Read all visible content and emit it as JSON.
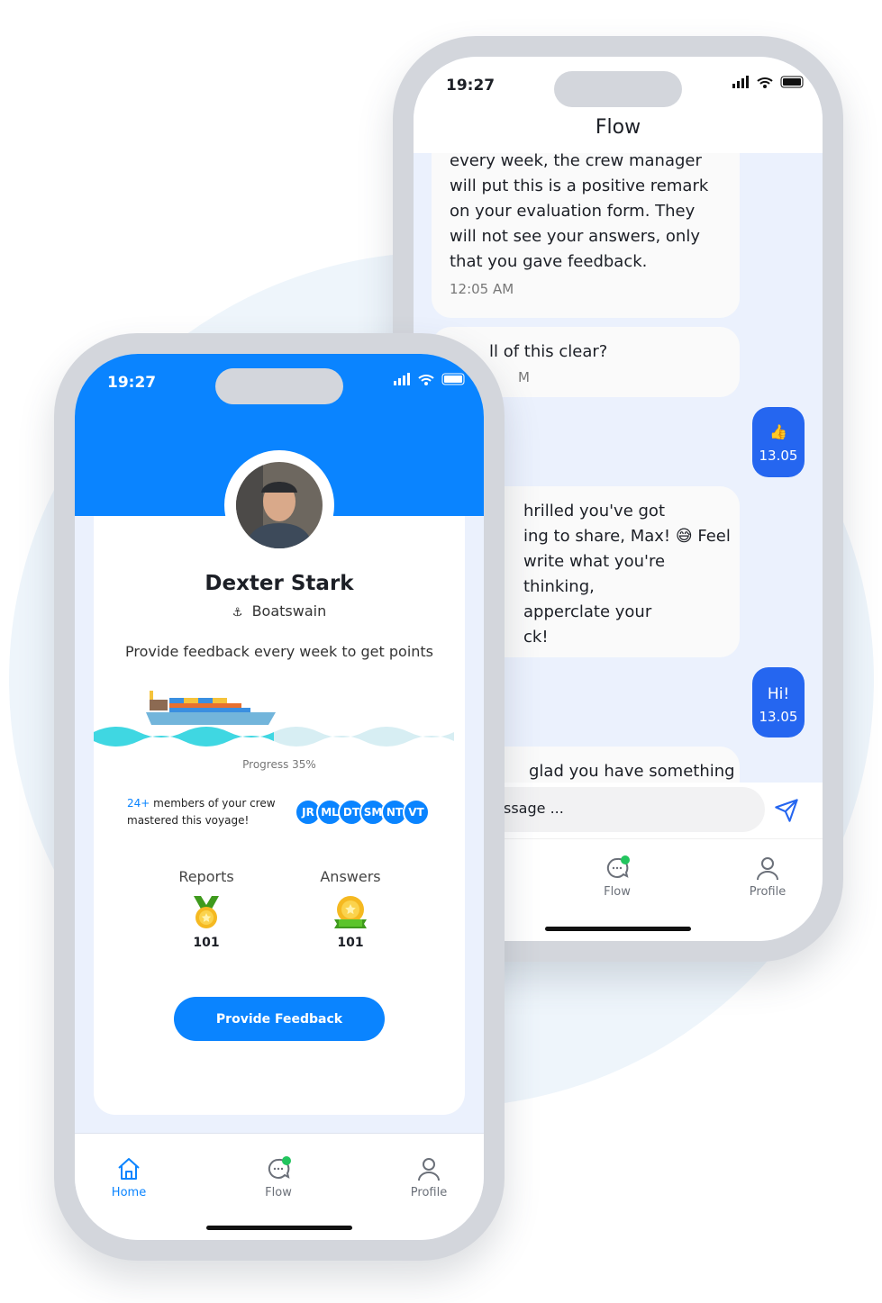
{
  "colors": {
    "accent": "#0a84ff",
    "send": "#2566f0",
    "online": "#22c55e"
  },
  "back_phone": {
    "status_time": "19:27",
    "title": "Flow",
    "messages": [
      {
        "text": "every week, the crew manager will put this is a positive remark on your evaluation form. They will not see your answers, only that you gave feedback.",
        "time": "12:05 AM"
      },
      {
        "text": "ll of this clear?",
        "time": "M"
      },
      {
        "mine": true,
        "emoji": "👍",
        "time": "13.05"
      },
      {
        "lines": [
          "hrilled you've got",
          "ing to share, Max! 😅 Feel",
          "write what you're thinking,",
          "apperclate your",
          "ck!"
        ]
      },
      {
        "mine": true,
        "text": "Hi!",
        "time": "13.05"
      },
      {
        "text": "glad you have something"
      }
    ],
    "input_placeholder": "ssage ...",
    "nav": [
      {
        "label": "Flow",
        "icon": "chat-icon"
      },
      {
        "label": "Profile",
        "icon": "user-icon"
      }
    ]
  },
  "front_phone": {
    "status_time": "19:27",
    "name": "Dexter Stark",
    "role": "Boatswain",
    "prompt": "Provide feedback every week to get points",
    "progress_label": "Progress 35%",
    "progress": 35,
    "crew_count": "24+",
    "crew_text": " members of your crew",
    "crew_text2": "mastered this voyage!",
    "avatars": [
      "JR",
      "ML",
      "DT",
      "SM",
      "NT",
      "VT"
    ],
    "stats": [
      {
        "label": "Reports",
        "value": "101",
        "icon": "medal-icon"
      },
      {
        "label": "Answers",
        "value": "101",
        "icon": "award-icon"
      }
    ],
    "cta": "Provide Feedback",
    "nav": [
      {
        "label": "Home",
        "icon": "home-icon",
        "active": true
      },
      {
        "label": "Flow",
        "icon": "chat-icon"
      },
      {
        "label": "Profile",
        "icon": "user-icon"
      }
    ]
  }
}
